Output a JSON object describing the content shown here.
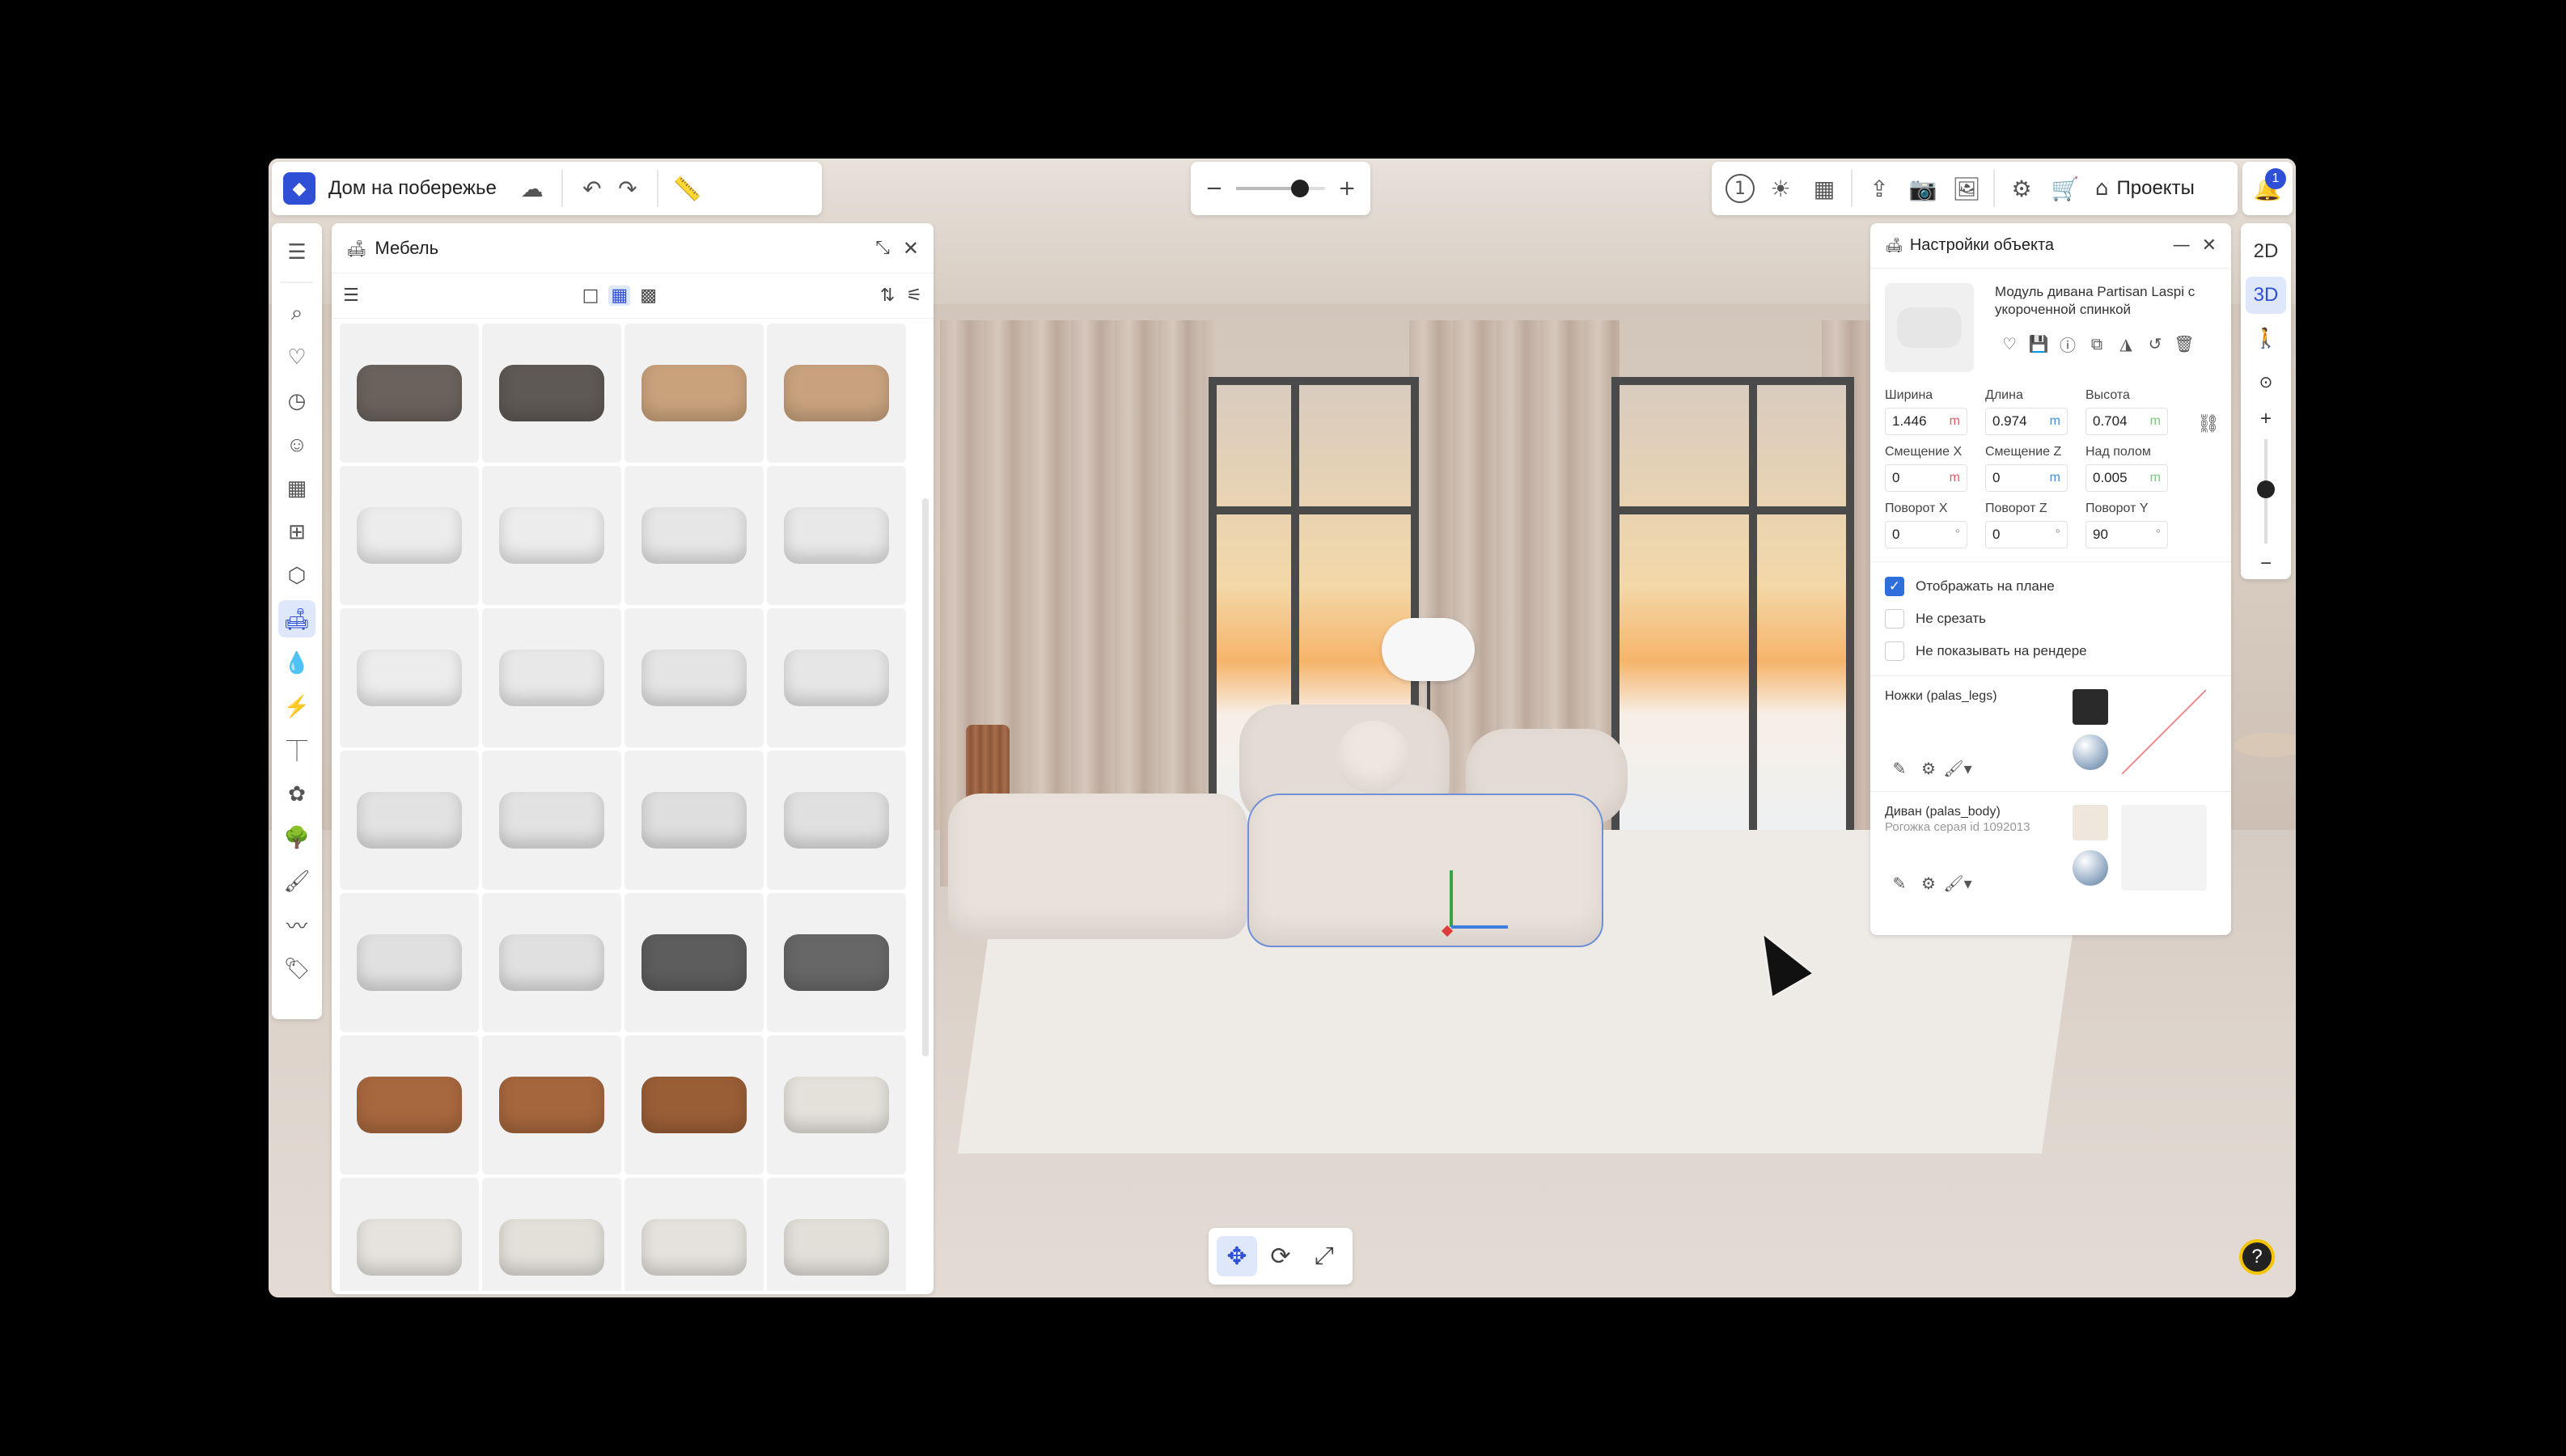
{
  "header": {
    "project_title": "Дом на побережье",
    "projects_label": "Проекты",
    "notification_count": "1",
    "step_label": "1"
  },
  "zoom": {
    "level": 0.72
  },
  "left_toolbar": {
    "items": [
      "list-icon",
      "search-icon",
      "heart-icon",
      "clock-icon",
      "user-icon",
      "walls-icon",
      "rooms-icon",
      "cube-icon",
      "sofa-icon",
      "drop-icon",
      "lightning-icon",
      "lamp-icon",
      "flower-icon",
      "tree-icon",
      "paint-roller-icon",
      "curve-icon",
      "tag-icon"
    ],
    "active_item": "sofa-icon"
  },
  "furniture_panel": {
    "title": "Мебель",
    "thumbnails": [
      {
        "color": "#6b625c"
      },
      {
        "color": "#5f5955"
      },
      {
        "color": "#c9a27c"
      },
      {
        "color": "#c8a27e"
      },
      {
        "color": "#ececec"
      },
      {
        "color": "#ececec"
      },
      {
        "color": "#e6e6e6"
      },
      {
        "color": "#e8e8e8"
      },
      {
        "color": "#ececec"
      },
      {
        "color": "#e8e8e8"
      },
      {
        "color": "#e4e4e4"
      },
      {
        "color": "#e6e6e6"
      },
      {
        "color": "#e2e2e2"
      },
      {
        "color": "#e2e2e2"
      },
      {
        "color": "#dedede"
      },
      {
        "color": "#e0e0e0"
      },
      {
        "color": "#e0e0e0"
      },
      {
        "color": "#e0e0e0"
      },
      {
        "color": "#5d5d5d"
      },
      {
        "color": "#676767"
      },
      {
        "color": "#a8683e"
      },
      {
        "color": "#a5663d"
      },
      {
        "color": "#9a5e37"
      },
      {
        "color": "#e4e0da"
      },
      {
        "color": "#e6e3de"
      },
      {
        "color": "#e3dfd9"
      },
      {
        "color": "#e5e1dc"
      },
      {
        "color": "#e2ded8"
      }
    ]
  },
  "object_settings": {
    "title": "Настройки объекта",
    "object_name": "Модуль дивана Partisan Laspi с укороченной спинкой",
    "fields": [
      {
        "label": "Ширина",
        "value": "1.446",
        "unit": "m",
        "unit_color": "#e05a6a"
      },
      {
        "label": "Длина",
        "value": "0.974",
        "unit": "m",
        "unit_color": "#3b8fe0"
      },
      {
        "label": "Высота",
        "value": "0.704",
        "unit": "m",
        "unit_color": "#7cc97c"
      },
      {
        "label": "Смещение X",
        "value": "0",
        "unit": "m",
        "unit_color": "#e05a6a"
      },
      {
        "label": "Смещение Z",
        "value": "0",
        "unit": "m",
        "unit_color": "#3b8fe0"
      },
      {
        "label": "Над полом",
        "value": "0.005",
        "unit": "m",
        "unit_color": "#7cc97c"
      },
      {
        "label": "Поворот X",
        "value": "0",
        "unit": "°",
        "unit_color": "#999999"
      },
      {
        "label": "Поворот Z",
        "value": "0",
        "unit": "°",
        "unit_color": "#999999"
      },
      {
        "label": "Поворот Y",
        "value": "90",
        "unit": "°",
        "unit_color": "#999999"
      }
    ],
    "checkboxes": [
      {
        "label": "Отображать на плане",
        "checked": true
      },
      {
        "label": "Не срезать",
        "checked": false
      },
      {
        "label": "Не показывать на рендере",
        "checked": false
      }
    ],
    "materials": [
      {
        "title": "Ножки (palas_legs)",
        "subtitle": "",
        "swatch_color": "#2a2a2a"
      },
      {
        "title": "Диван (palas_body)",
        "subtitle": "Рогожка серая id 1092013",
        "swatch_color": "#efe6dc"
      }
    ]
  },
  "view_modes": {
    "two_d": "2D",
    "three_d": "3D",
    "active": "3D"
  },
  "camera_zoom": {
    "level": 0.48
  },
  "help_label": "?"
}
